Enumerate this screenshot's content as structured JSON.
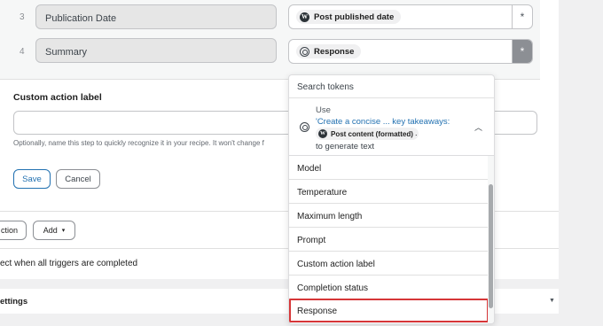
{
  "mapping_rows": [
    {
      "num": "3",
      "field": "Publication Date",
      "token": "Post published date",
      "token_icon": "wordpress-icon",
      "asterisk": "*"
    },
    {
      "num": "4",
      "field": "Summary",
      "token": "Response",
      "token_icon": "ai-icon",
      "asterisk": "*"
    }
  ],
  "custom_action": {
    "label": "Custom action label",
    "value": "",
    "help": "Optionally, name this step to quickly recognize it in your recipe. It won't change f"
  },
  "buttons": {
    "save": "Save",
    "cancel": "Cancel",
    "action": "ction",
    "add": "Add",
    "add_chevron": "▾"
  },
  "triggers_text": "ect when all triggers are completed",
  "settings_text": "ettings",
  "settings_caret": "▼",
  "token_dropdown": {
    "search_placeholder": "Search tokens",
    "use_word": "Use",
    "use_link": "'Create a concise ... key takeaways:",
    "use_pill": "Post content (formatted)",
    "use_dot": ".",
    "use_generate": "to generate text",
    "use_chevron": "︿",
    "items": [
      "Model",
      "Temperature",
      "Maximum length",
      "Prompt",
      "Custom action label",
      "Completion status",
      "Response"
    ],
    "highlighted_item": "Response"
  },
  "colors": {
    "accent": "#2271b1",
    "highlight_border": "#d63638"
  }
}
